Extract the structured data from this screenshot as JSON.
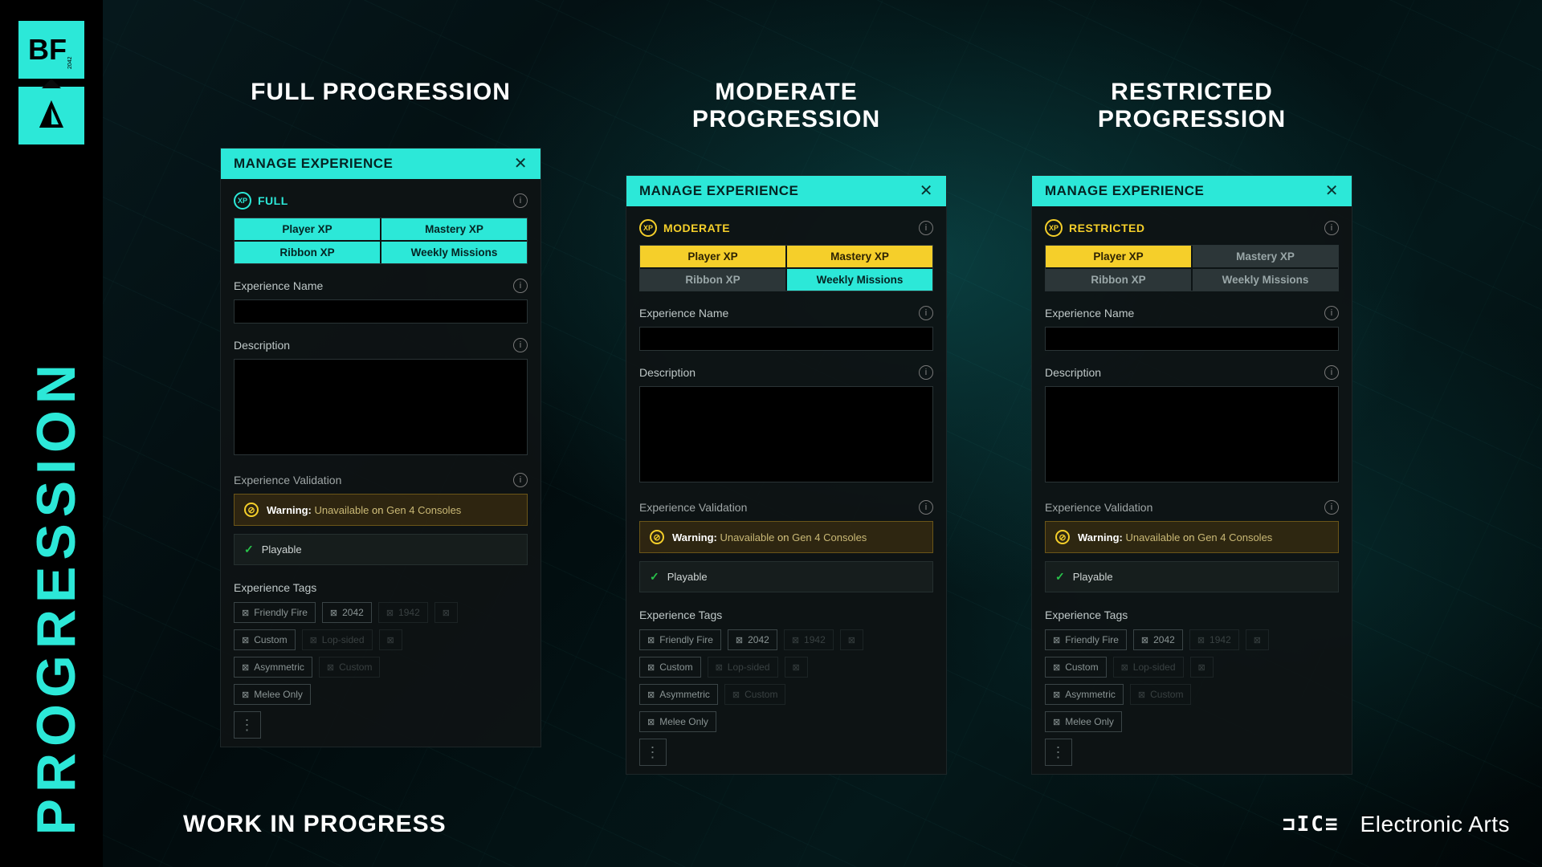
{
  "sidebar": {
    "vertical_title": "PROGRESSION",
    "bf_text": "BF",
    "bf_year": "2042"
  },
  "columns": [
    {
      "title": "FULL PROGRESSION",
      "panel_title": "MANAGE EXPERIENCE",
      "xp_mode": "FULL",
      "xp_class": "xp-full",
      "chips": [
        {
          "label": "Player XP",
          "style": "chip-cyan"
        },
        {
          "label": "Mastery XP",
          "style": "chip-cyan"
        },
        {
          "label": "Ribbon XP",
          "style": "chip-cyan"
        },
        {
          "label": "Weekly Missions",
          "style": "chip-cyan"
        }
      ]
    },
    {
      "title": "MODERATE PROGRESSION",
      "panel_title": "MANAGE EXPERIENCE",
      "xp_mode": "MODERATE",
      "xp_class": "xp-moderate",
      "chips": [
        {
          "label": "Player XP",
          "style": "chip-yellow"
        },
        {
          "label": "Mastery XP",
          "style": "chip-yellow"
        },
        {
          "label": "Ribbon XP",
          "style": "chip-dark"
        },
        {
          "label": "Weekly Missions",
          "style": "chip-cyan"
        }
      ]
    },
    {
      "title": "RESTRICTED PROGRESSION",
      "panel_title": "MANAGE EXPERIENCE",
      "xp_mode": "RESTRICTED",
      "xp_class": "xp-restricted",
      "chips": [
        {
          "label": "Player XP",
          "style": "chip-yellow"
        },
        {
          "label": "Mastery XP",
          "style": "chip-dark"
        },
        {
          "label": "Ribbon XP",
          "style": "chip-dark"
        },
        {
          "label": "Weekly Missions",
          "style": "chip-dark"
        }
      ]
    }
  ],
  "common": {
    "exp_name_label": "Experience Name",
    "desc_label": "Description",
    "validation_label": "Experience Validation",
    "warning_prefix": "Warning:",
    "warning_mid": " Unavailable ",
    "warning_on": "on",
    "warning_suffix": " Gen 4 Consoles",
    "playable": "Playable",
    "tags_label": "Experience Tags",
    "tags": [
      [
        {
          "t": "Friendly Fire",
          "f": 0
        },
        {
          "t": "2042",
          "f": 0
        },
        {
          "t": "1942",
          "f": 1
        },
        {
          "t": "",
          "f": 1
        }
      ],
      [
        {
          "t": "Custom",
          "f": 0
        },
        {
          "t": "Lop-sided",
          "f": 1
        },
        {
          "t": "",
          "f": 1
        }
      ],
      [
        {
          "t": "Asymmetric",
          "f": 0
        },
        {
          "t": "Custom",
          "f": 1
        }
      ],
      [
        {
          "t": "Melee Only",
          "f": 0
        }
      ]
    ]
  },
  "footer": {
    "wip": "WORK IN PROGRESS",
    "dice": "⊐IC≡",
    "ea": "Electronic Arts"
  }
}
